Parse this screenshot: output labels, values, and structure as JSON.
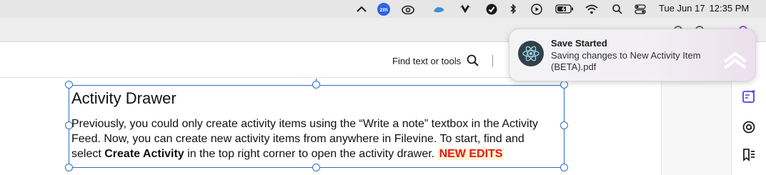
{
  "menubar": {
    "date": "Tue Jun 17",
    "time": "12:35 PM",
    "zoom_label": "zm",
    "icons": [
      "chevron-up-icon",
      "zoom-icon",
      "creative-cloud-icon",
      "cloud-sync-icon",
      "wings-icon",
      "check-circle-icon",
      "bluetooth-icon",
      "play-circle-icon",
      "battery-icon",
      "wifi-icon",
      "search-icon",
      "control-center-icon"
    ]
  },
  "toolbar": {
    "find_label": "Find text or tools"
  },
  "document": {
    "heading": "Activity Drawer",
    "line1": "Previously, you could only create activity items using the “Write a note” textbox in the Activity",
    "line2": "Feed. Now, you can create new activity items from anywhere in Filevine. To start, find and",
    "line3_before": "select ",
    "line3_bold": "Create Activity",
    "line3_after": " in the top right corner to open the activity drawer. ",
    "new_edits": "NEW EDITS"
  },
  "notification": {
    "title": "Save Started",
    "body": "Saving changes to New Activity Item (BETA).pdf"
  },
  "right_rail": {
    "icons": [
      "form-edit-icon",
      "comment-icon",
      "bookmark-list-icon"
    ]
  },
  "colors": {
    "selection": "#2a6fc9",
    "new_edits_text": "#e8141b",
    "new_edits_highlight": "#fdf3d2",
    "rail_accent": "#5a3fd8"
  }
}
